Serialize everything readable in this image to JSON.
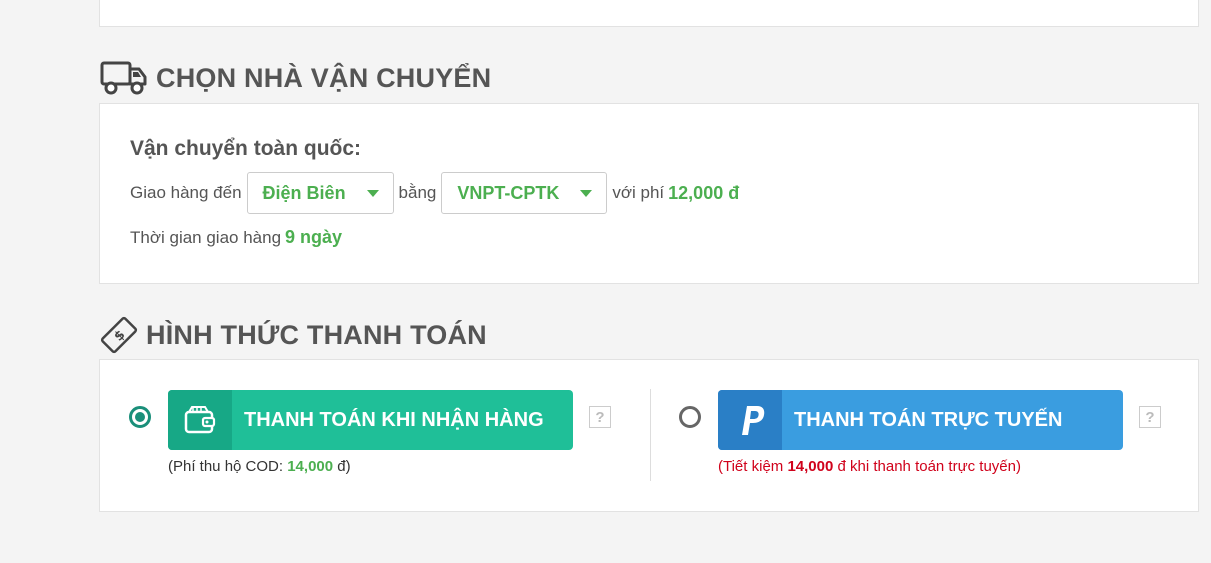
{
  "shipping": {
    "title": "CHỌN NHÀ VẬN CHUYỂN",
    "icon": "truck-icon",
    "heading": "Vận chuyển toàn quốc:",
    "deliver_to_label": "Giao hàng đến",
    "province_value": "Điện Biên",
    "by_label": "bằng",
    "carrier_value": "VNPT-CPTK",
    "fee_label": "với phí",
    "fee_value": "12,000 đ",
    "time_label": "Thời gian giao hàng",
    "time_value": "9 ngày"
  },
  "payment": {
    "title": "HÌNH THỨC THANH TOÁN",
    "icon": "money-bill-icon",
    "cod": {
      "selected": true,
      "label": "THANH TOÁN KHI NHẬN HÀNG",
      "icon": "wallet-icon",
      "help": "?",
      "note_prefix": "(Phí thu hộ COD: ",
      "note_amount": "14,000",
      "note_suffix": " đ)"
    },
    "online": {
      "selected": false,
      "label": "THANH TOÁN TRỰC TUYẾN",
      "icon": "paypal-icon",
      "help": "?",
      "note_prefix": "(Tiết kiệm ",
      "note_amount": "14,000",
      "note_suffix": " đ khi thanh toán trực tuyến)"
    }
  },
  "colors": {
    "green": "#4caf50",
    "cod_button": "#1fbf98",
    "online_button": "#3a9de0",
    "savings_red": "#d0021b"
  }
}
